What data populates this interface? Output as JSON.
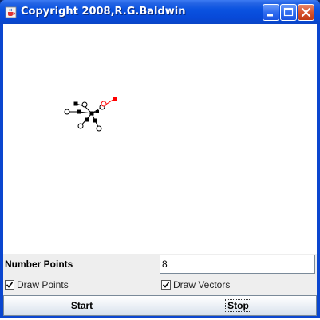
{
  "window": {
    "title": "Copyright 2008,R.G.Baldwin"
  },
  "controls": {
    "number_points_label": "Number Points",
    "number_points_value": "8",
    "draw_points_label": "Draw Points",
    "draw_points_checked": true,
    "draw_vectors_label": "Draw Vectors",
    "draw_vectors_checked": true,
    "start_label": "Start",
    "stop_label": "Stop"
  },
  "icons": {
    "app": "java-coffee-cup-icon",
    "minimize": "minimize-icon",
    "maximize": "maximize-icon",
    "close": "close-icon"
  },
  "colors": {
    "titlebar": "#0a52e0",
    "highlight_point": "#ff0000",
    "points": "#000000"
  }
}
